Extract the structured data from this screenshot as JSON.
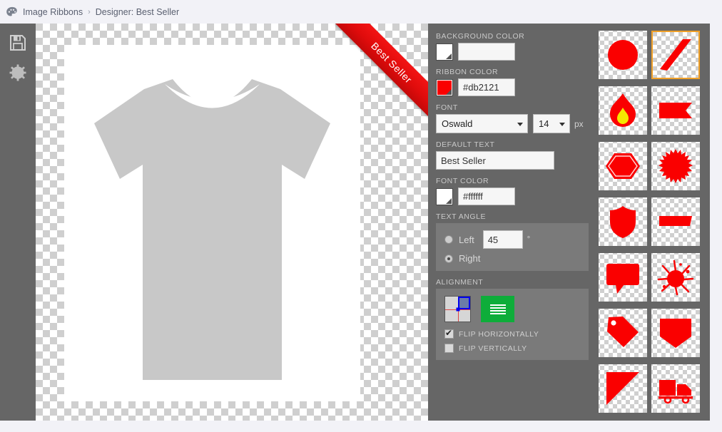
{
  "breadcrumb": {
    "home_icon": "palette-icon",
    "items": [
      "Image Ribbons",
      "Designer: Best Seller"
    ],
    "separator": "›"
  },
  "toolbar": {
    "save_icon": "save-icon",
    "settings_icon": "gear-icon"
  },
  "canvas": {
    "ribbon_text": "Best Seller",
    "shirt_color": "#c8c8c8",
    "image_background": "#ffffff"
  },
  "settings": {
    "background_color": {
      "label": "BACKGROUND COLOR",
      "swatch": "#ffffff",
      "value": ""
    },
    "ribbon_color": {
      "label": "RIBBON COLOR",
      "swatch": "#fa0000",
      "value": "#db2121"
    },
    "font": {
      "label": "FONT",
      "family": "Oswald",
      "family_options": [
        "Oswald"
      ],
      "size": "14",
      "size_options": [
        "14"
      ],
      "unit": "px"
    },
    "default_text": {
      "label": "DEFAULT TEXT",
      "value": "Best Seller"
    },
    "font_color": {
      "label": "FONT COLOR",
      "swatch": "#ffffff",
      "value": "#ffffff"
    },
    "text_angle": {
      "label": "TEXT ANGLE",
      "left_label": "Left",
      "right_label": "Right",
      "selected": "Right",
      "angle": "45",
      "degree_symbol": "°"
    },
    "alignment": {
      "label": "ALIGNMENT",
      "grid_quadrant": "top-right",
      "text_align_icon": "text-align-icon",
      "flip_horizontally": {
        "label": "FLIP HORIZONTALLY",
        "checked": true
      },
      "flip_vertically": {
        "label": "FLIP VERTICALLY",
        "checked": false
      }
    }
  },
  "gallery": {
    "accent_color": "#f0a028",
    "shape_color": "#fa0000",
    "items": [
      {
        "name": "circle",
        "selected": false
      },
      {
        "name": "diagonal-ribbon",
        "selected": true
      },
      {
        "name": "flame",
        "selected": false
      },
      {
        "name": "banner-flag",
        "selected": false
      },
      {
        "name": "hexagon",
        "selected": false
      },
      {
        "name": "starburst",
        "selected": false
      },
      {
        "name": "shield",
        "selected": false
      },
      {
        "name": "slanted-bar",
        "selected": false
      },
      {
        "name": "speech-bubble",
        "selected": false
      },
      {
        "name": "splatter",
        "selected": false
      },
      {
        "name": "price-tag",
        "selected": false
      },
      {
        "name": "pocket-banner",
        "selected": false
      },
      {
        "name": "corner-triangle",
        "selected": false
      },
      {
        "name": "delivery-truck",
        "selected": false
      }
    ]
  }
}
